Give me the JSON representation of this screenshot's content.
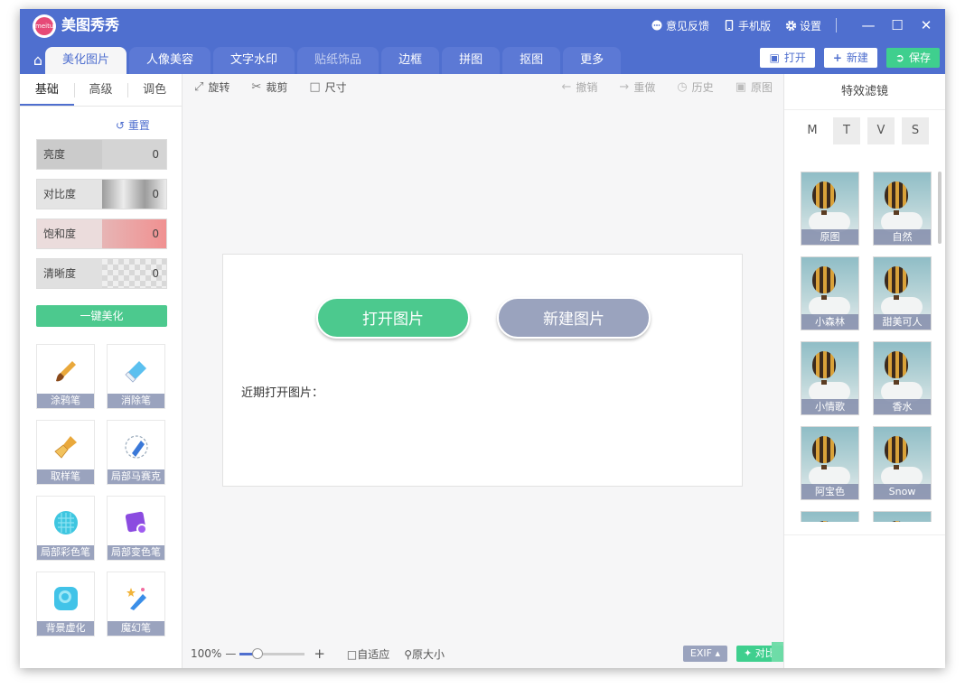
{
  "app": {
    "title": "美图秀秀",
    "logo_text": "meitu"
  },
  "title_bar": {
    "feedback": "意见反馈",
    "mobile": "手机版",
    "settings": "设置"
  },
  "tabs": [
    {
      "label": "美化图片",
      "active": true
    },
    {
      "label": "人像美容"
    },
    {
      "label": "文字水印"
    },
    {
      "label": "贴纸饰品",
      "dim": true
    },
    {
      "label": "边框"
    },
    {
      "label": "拼图"
    },
    {
      "label": "抠图"
    },
    {
      "label": "更多"
    }
  ],
  "actions": {
    "open": "打开",
    "new": "新建",
    "save": "保存"
  },
  "left_panel": {
    "subtabs": [
      "基础",
      "高级",
      "调色"
    ],
    "reset": "重置",
    "sliders": [
      {
        "label": "亮度",
        "value": "0"
      },
      {
        "label": "对比度",
        "value": "0"
      },
      {
        "label": "饱和度",
        "value": "0"
      },
      {
        "label": "清晰度",
        "value": "0"
      }
    ],
    "one_key": "一键美化",
    "tools": [
      {
        "label": "涂鸦笔",
        "icon": "brush-icon"
      },
      {
        "label": "消除笔",
        "icon": "eraser-icon"
      },
      {
        "label": "取样笔",
        "icon": "sample-brush-icon"
      },
      {
        "label": "局部马赛克",
        "icon": "mosaic-pen-icon"
      },
      {
        "label": "局部彩色笔",
        "icon": "color-pen-icon"
      },
      {
        "label": "局部变色笔",
        "icon": "recolor-pen-icon"
      },
      {
        "label": "背景虚化",
        "icon": "blur-icon"
      },
      {
        "label": "魔幻笔",
        "icon": "magic-pen-icon"
      }
    ]
  },
  "toolbar": {
    "rotate": "旋转",
    "crop": "裁剪",
    "size": "尺寸",
    "undo": "撤销",
    "redo": "重做",
    "history": "历史",
    "original": "原图"
  },
  "canvas": {
    "open_image": "打开图片",
    "new_image": "新建图片",
    "recent_label": "近期打开图片："
  },
  "bottom": {
    "zoom": "100%",
    "zoom_fraction": 0.27,
    "fit": "自适应",
    "actual": "原大小",
    "exif": "EXIF",
    "compare": "对比"
  },
  "right_panel": {
    "title": "特效滤镜",
    "mode_tabs": [
      "M",
      "T",
      "V",
      "S"
    ],
    "filters": [
      "原图",
      "自然",
      "小森林",
      "甜美可人",
      "小情歌",
      "香水",
      "阿宝色",
      "Snow",
      "",
      ""
    ]
  },
  "colors": {
    "brand_blue": "#4f6fcf",
    "green": "#4cc98e",
    "gray_blue": "#9aa3be"
  }
}
